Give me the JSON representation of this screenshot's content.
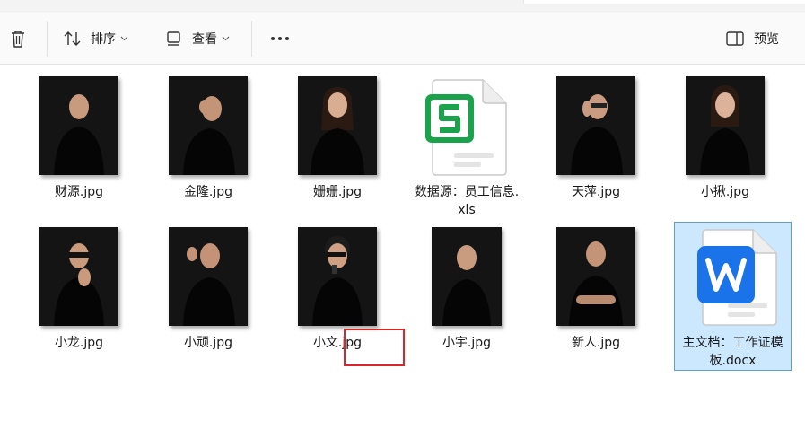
{
  "toolbar": {
    "sort_label": "排序",
    "view_label": "查看",
    "preview_label": "预览"
  },
  "files": [
    {
      "name": "财源.jpg",
      "type": "photo"
    },
    {
      "name": "金隆.jpg",
      "type": "photo"
    },
    {
      "name": "姗姗.jpg",
      "type": "photo"
    },
    {
      "name": "数据源：员工信息.xls",
      "type": "xls"
    },
    {
      "name": "天萍.jpg",
      "type": "photo"
    },
    {
      "name": "小揪.jpg",
      "type": "photo"
    },
    {
      "name": "小龙.jpg",
      "type": "photo"
    },
    {
      "name": "小顽.jpg",
      "type": "photo"
    },
    {
      "name": "小文.jpg",
      "type": "photo"
    },
    {
      "name": "小宇.jpg",
      "type": "photo"
    },
    {
      "name": "新人.jpg",
      "type": "photo"
    },
    {
      "name": "主文档：工作证模板.docx",
      "type": "docx",
      "selected": true
    }
  ],
  "colors": {
    "xls_accent": "#1aa34a",
    "docx_accent": "#1a73e8",
    "selection_bg": "#cce8ff",
    "highlight_box": "#d9262b"
  }
}
